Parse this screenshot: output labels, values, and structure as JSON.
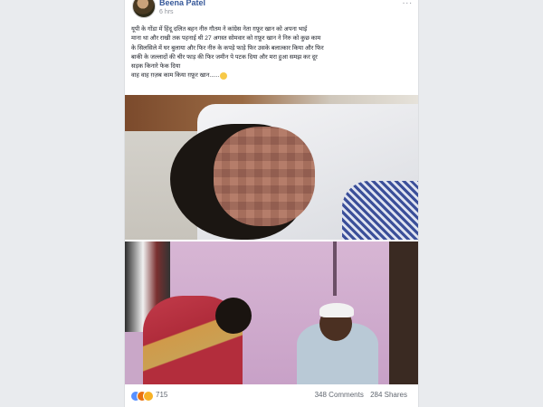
{
  "post": {
    "author": "Beena Patel",
    "time": "6 hrs",
    "more": "...",
    "text_lines": [
      "यूपी के गोंडा में हिंदू दलित बहन नीरु गौतम ने कांग्रेस नेता ग़फ़ूर खान को अपना भाई",
      "माना था और राखी तक पहनाई थी 27 अगस्त सोमवार को ग़फ़ूर खान ने निरु को कुछ काम",
      "के सिलसिले में घर बुलाया और फिर नीरु के कपड़े फाड़े फिर उसके बलात्कार किया और फिर",
      "बाकी के जल्लादों की चीर फाड़ की फिर जमीन पे पटक दिया और मरा हुआ समझ कर दूर",
      "सड़क किनारे फेक दिया",
      "वाह वाह ग़ज़ब काम किया ग़फ़ूर खान......"
    ]
  },
  "footer": {
    "reaction_count": "715",
    "comments": "348 Comments",
    "shares": "284 Shares"
  },
  "icons": {
    "reactions": [
      "like-reaction-icon",
      "angry-reaction-icon",
      "sad-reaction-icon"
    ],
    "emoji": "smile-emoji-icon"
  },
  "colors": {
    "author_link": "#365899",
    "like": "#5890ff",
    "angry": "#e9710f",
    "sad": "#f7b125"
  }
}
